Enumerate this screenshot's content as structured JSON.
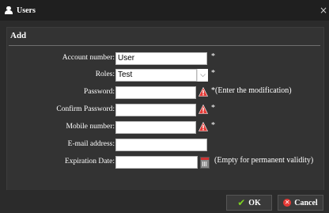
{
  "window": {
    "title": "Users",
    "icon": "user-icon",
    "close_glyph": "×"
  },
  "section": {
    "title": "Add"
  },
  "form": {
    "account_number": {
      "label": "Account number:",
      "value": "User",
      "mark": "*"
    },
    "roles": {
      "label": "Roles:",
      "value": "Test",
      "mark": "*"
    },
    "password": {
      "label": "Password:",
      "value": "",
      "mark": "*(Enter the modification)"
    },
    "confirm_password": {
      "label": "Confirm Password:",
      "value": "",
      "mark": "*"
    },
    "mobile_number": {
      "label": "Mobile number:",
      "value": "",
      "mark": "*"
    },
    "email": {
      "label": "E-mail address:",
      "value": ""
    },
    "expiration_date": {
      "label": "Expiration Date:",
      "value": "",
      "mark": "(Empty for permanent validity)"
    }
  },
  "buttons": {
    "ok_label": "OK",
    "cancel_label": "Cancel"
  },
  "colors": {
    "background": "#2b2b2b",
    "panel": "#333333",
    "warning": "#e53935",
    "ok_check": "#7ed321"
  }
}
